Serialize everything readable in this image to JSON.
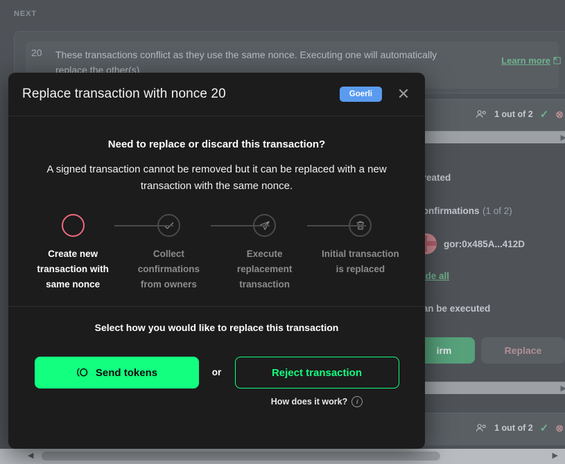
{
  "background": {
    "next_label": "NEXT",
    "banner": {
      "nonce": "20",
      "text": "These transactions conflict as they use the same nonce. Executing one will automatically replace the other(s)",
      "learn_more": "Learn more",
      "learn_more_icon": "external-link-icon"
    },
    "rows": [
      {
        "confirmations": "1 out of 2",
        "owners_icon": "owners-icon",
        "check_icon": "check-icon",
        "cancel_icon": "cancel-circle-icon"
      },
      {
        "confirmations": "1 out of 2",
        "owners_icon": "owners-icon",
        "check_icon": "check-icon",
        "cancel_icon": "cancel-circle-icon"
      }
    ],
    "details": {
      "created_label": "Created",
      "confirmations_label": "Confirmations",
      "confirmations_count": "(1 of 2)",
      "owner_address": "gor:0x485A...412D",
      "hide_all": "Hide all",
      "status": "Can be executed"
    },
    "buttons": {
      "confirm": "Confirm",
      "confirm_visible": "irm",
      "replace": "Replace"
    }
  },
  "modal": {
    "title": "Replace transaction with nonce 20",
    "network_chip": "Goerli",
    "close_icon": "close-icon",
    "heading": "Need to replace or discard this transaction?",
    "description": "A signed transaction cannot be removed but it can be replaced with a new transaction with the same nonce.",
    "steps": [
      {
        "label": "Create new transaction with same nonce",
        "icon": "empty-circle-icon",
        "active": true
      },
      {
        "label": "Collect confirmations from owners",
        "icon": "check-icon",
        "active": false
      },
      {
        "label": "Execute replacement transaction",
        "icon": "paper-plane-icon",
        "active": false
      },
      {
        "label": "Initial transaction is replaced",
        "icon": "trash-icon",
        "active": false
      }
    ],
    "footer": {
      "prompt": "Select how you would like to replace this transaction",
      "send_tokens_label": "Send tokens",
      "send_tokens_icon": "token-coin-icon",
      "or_label": "or",
      "reject_label": "Reject transaction",
      "how_label": "How does it work?",
      "how_icon": "info-icon"
    }
  },
  "colors": {
    "accent_green": "#12ff80",
    "chip_blue": "#5a9bf0",
    "active_step_pink": "#f06a7e",
    "modal_bg": "#1c1c1c",
    "backdrop": "#4f5358"
  }
}
